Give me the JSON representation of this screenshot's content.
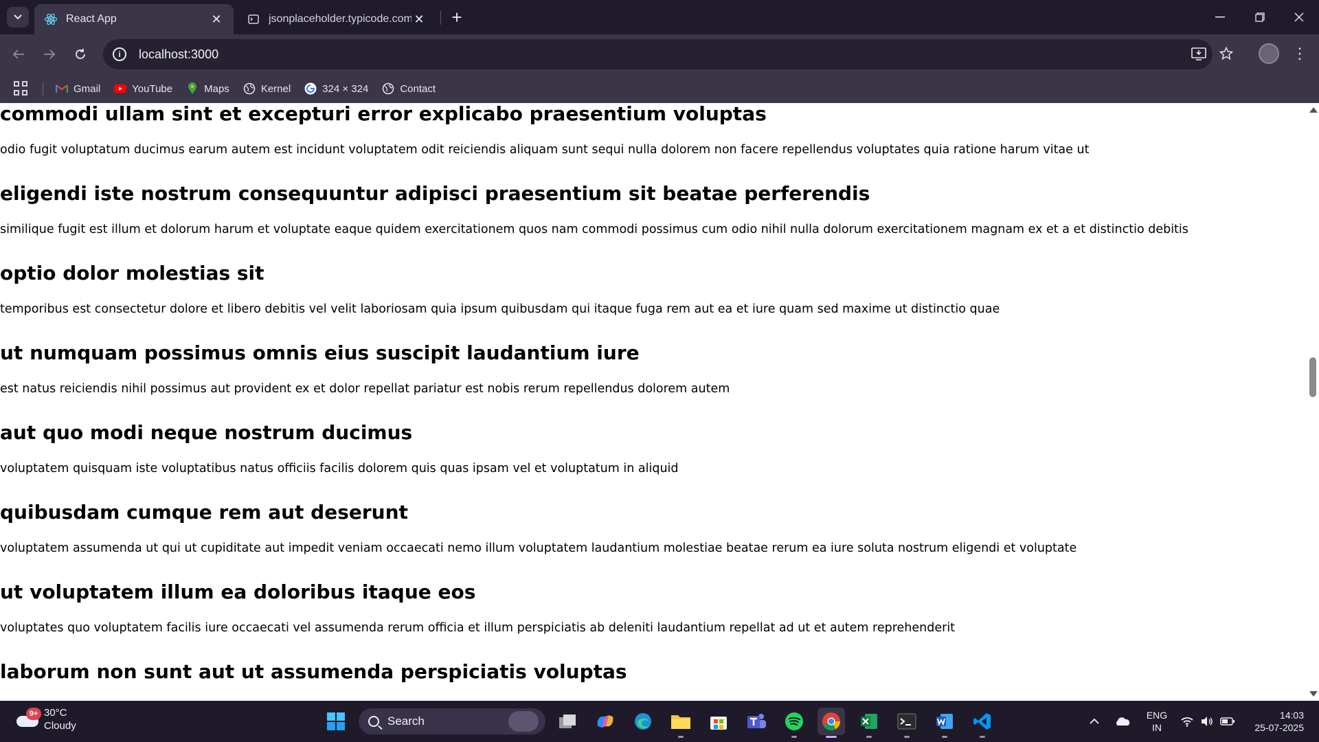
{
  "browser": {
    "tabs": [
      {
        "title": "React App",
        "active": true
      },
      {
        "title": "jsonplaceholder.typicode.com/p",
        "active": false
      }
    ],
    "url": "localhost:3000",
    "bookmarks": [
      {
        "label": "Gmail",
        "icon": "gmail-icon"
      },
      {
        "label": "YouTube",
        "icon": "youtube-icon"
      },
      {
        "label": "Maps",
        "icon": "maps-icon"
      },
      {
        "label": "Kernel",
        "icon": "globe-icon"
      },
      {
        "label": "324 × 324",
        "icon": "google-icon"
      },
      {
        "label": "Contact",
        "icon": "globe-icon"
      }
    ]
  },
  "posts": [
    {
      "title": "commodi ullam sint et excepturi error explicabo praesentium voluptas",
      "body": "odio fugit voluptatum ducimus earum autem est incidunt voluptatem odit reiciendis aliquam sunt sequi nulla dolorem non facere repellendus voluptates quia ratione harum vitae ut"
    },
    {
      "title": "eligendi iste nostrum consequuntur adipisci praesentium sit beatae perferendis",
      "body": "similique fugit est illum et dolorum harum et voluptate eaque quidem exercitationem quos nam commodi possimus cum odio nihil nulla dolorum exercitationem magnam ex et a et distinctio debitis"
    },
    {
      "title": "optio dolor molestias sit",
      "body": "temporibus est consectetur dolore et libero debitis vel velit laboriosam quia ipsum quibusdam qui itaque fuga rem aut ea et iure quam sed maxime ut distinctio quae"
    },
    {
      "title": "ut numquam possimus omnis eius suscipit laudantium iure",
      "body": "est natus reiciendis nihil possimus aut provident ex et dolor repellat pariatur est nobis rerum repellendus dolorem autem"
    },
    {
      "title": "aut quo modi neque nostrum ducimus",
      "body": "voluptatem quisquam iste voluptatibus natus officiis facilis dolorem quis quas ipsam vel et voluptatum in aliquid"
    },
    {
      "title": "quibusdam cumque rem aut deserunt",
      "body": "voluptatem assumenda ut qui ut cupiditate aut impedit veniam occaecati nemo illum voluptatem laudantium molestiae beatae rerum ea iure soluta nostrum eligendi et voluptate"
    },
    {
      "title": "ut voluptatem illum ea doloribus itaque eos",
      "body": "voluptates quo voluptatem facilis iure occaecati vel assumenda rerum officia et illum perspiciatis ab deleniti laudantium repellat ad ut et autem reprehenderit"
    },
    {
      "title": "laborum non sunt aut ut assumenda perspiciatis voluptas",
      "body": ""
    }
  ],
  "taskbar": {
    "weather": {
      "temp": "30°C",
      "condition": "Cloudy",
      "badge": "9+"
    },
    "search_label": "Search",
    "language": {
      "line1": "ENG",
      "line2": "IN"
    },
    "clock": {
      "time": "14:03",
      "date": "25-07-2025"
    }
  }
}
